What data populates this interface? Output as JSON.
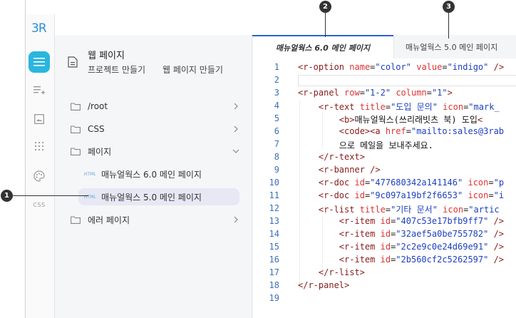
{
  "app": {
    "logo": "3R",
    "rail_css_label": "CSS"
  },
  "project": {
    "title": "웹 페이지",
    "breadcrumb_project": "프로젝트 만들기",
    "breadcrumb_page": "웹 페이지 만들기"
  },
  "tree": {
    "folders": [
      "/root",
      "CSS",
      "페이지",
      "에러 페이지"
    ],
    "children": [
      {
        "badge": "HTML",
        "label": "매뉴얼웍스 6.0 메인 페이지"
      },
      {
        "badge": "HTML",
        "label": "매뉴얼웍스 5.0 메인 페이지"
      }
    ]
  },
  "tabs": [
    {
      "label": "매뉴얼웍스 6.0 메인 페이지"
    },
    {
      "label": "매뉴얼웍스 5.0 메인 페이지"
    }
  ],
  "callouts": [
    "1",
    "2",
    "3"
  ],
  "editor": {
    "line_numbers": [
      "1",
      "2",
      "3",
      "4",
      "5",
      "6",
      "7",
      "8",
      "9",
      "10",
      "11",
      "12",
      "13",
      "14",
      "15",
      "16",
      "17",
      "18",
      "19"
    ]
  },
  "colors": {
    "accent": "#2b62d6",
    "rail_active": "#29b6df",
    "selected_row": "#e6e8f4"
  }
}
